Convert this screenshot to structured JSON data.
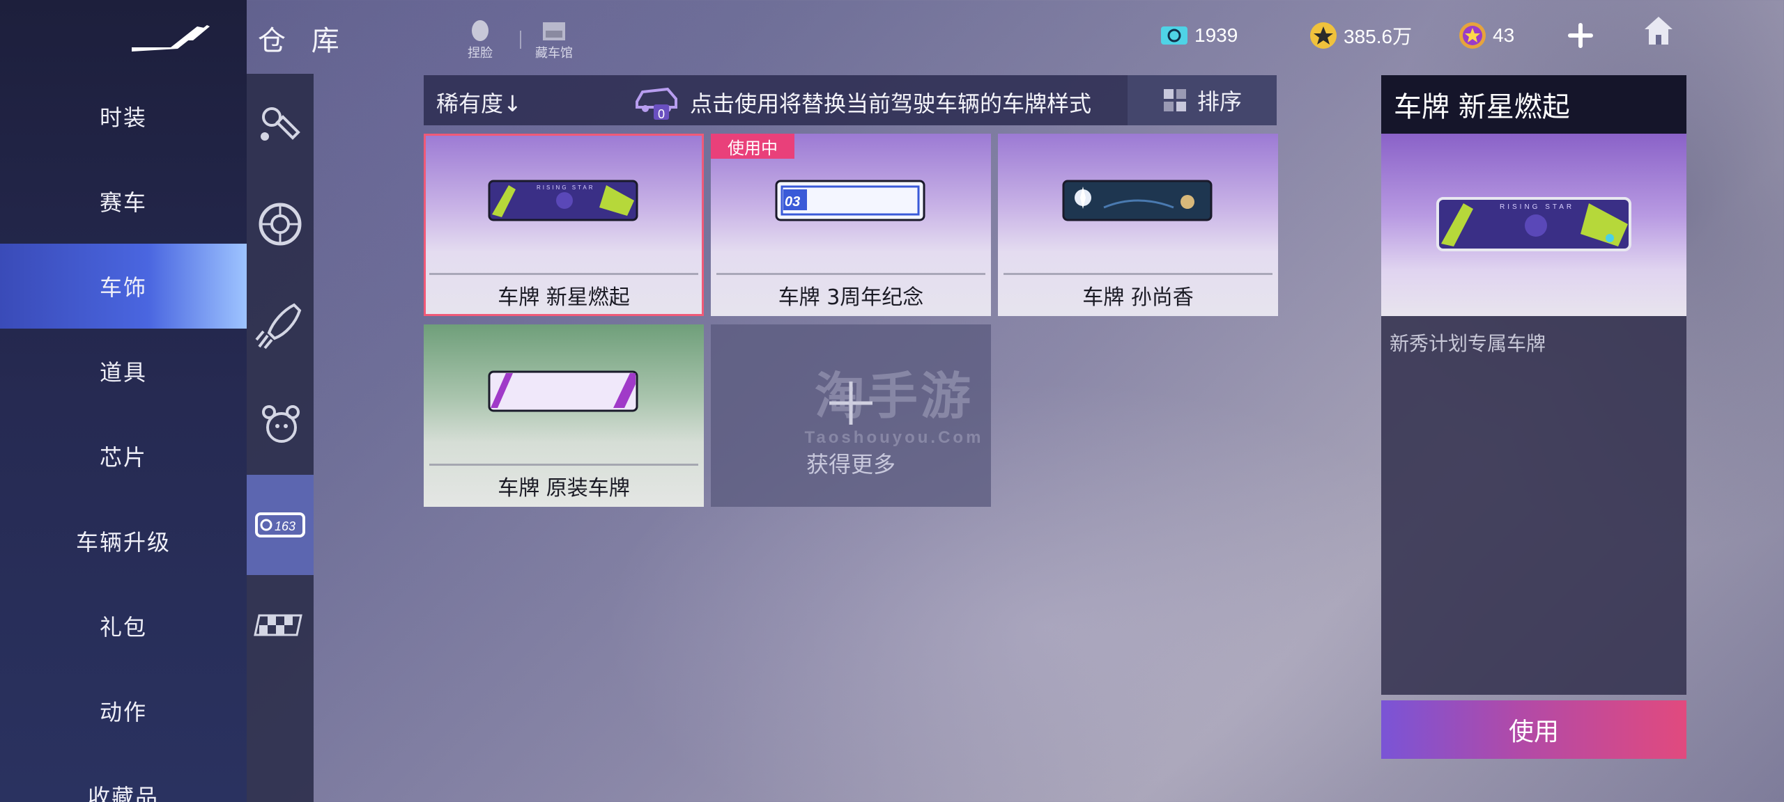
{
  "header": {
    "title": "仓 库",
    "face_label": "捏脸",
    "garage_label": "藏车馆",
    "tickets": "1939",
    "coins": "385.6万",
    "gems": "43"
  },
  "nav": {
    "items": [
      {
        "label": "时装"
      },
      {
        "label": "赛车"
      },
      {
        "label": "车饰"
      },
      {
        "label": "道具"
      },
      {
        "label": "芯片"
      },
      {
        "label": "车辆升级"
      },
      {
        "label": "礼包"
      },
      {
        "label": "动作"
      },
      {
        "label": "收藏品"
      }
    ],
    "active_index": 2
  },
  "subnav": {
    "icons": [
      "paint-spray-icon",
      "wheel-icon",
      "rocket-flame-icon",
      "pet-icon",
      "license-plate-icon",
      "checkered-flag-icon"
    ],
    "plate_icon_text": "163",
    "active_index": 4
  },
  "toolbar": {
    "sort_rarity": "稀有度↓",
    "hint_count": "0",
    "hint": "点击使用将替换当前驾驶车辆的车牌样式",
    "sort_label": "排序"
  },
  "items": [
    {
      "name": "车牌 新星燃起",
      "plate_text": "RISING STAR",
      "selected": true,
      "in_use": false
    },
    {
      "name": "车牌 3周年纪念",
      "plate_text": "03",
      "selected": false,
      "in_use": true
    },
    {
      "name": "车牌 孙尚香",
      "selected": false,
      "in_use": false
    },
    {
      "name": "车牌 原装车牌",
      "selected": false,
      "in_use": false
    }
  ],
  "in_use_badge": "使用中",
  "more": {
    "label": "获得更多"
  },
  "watermark": {
    "cn": "淘手游",
    "en": "Taoshouyou.Com"
  },
  "detail": {
    "title": "车牌 新星燃起",
    "plate_text": "RISING STAR",
    "description": "新秀计划专属车牌",
    "use_label": "使用"
  },
  "colors": {
    "accent_pink": "#e9407a",
    "nav_active": "#4a66e0",
    "use_gradient_start": "#7a54d6",
    "use_gradient_end": "#e14a7e"
  }
}
